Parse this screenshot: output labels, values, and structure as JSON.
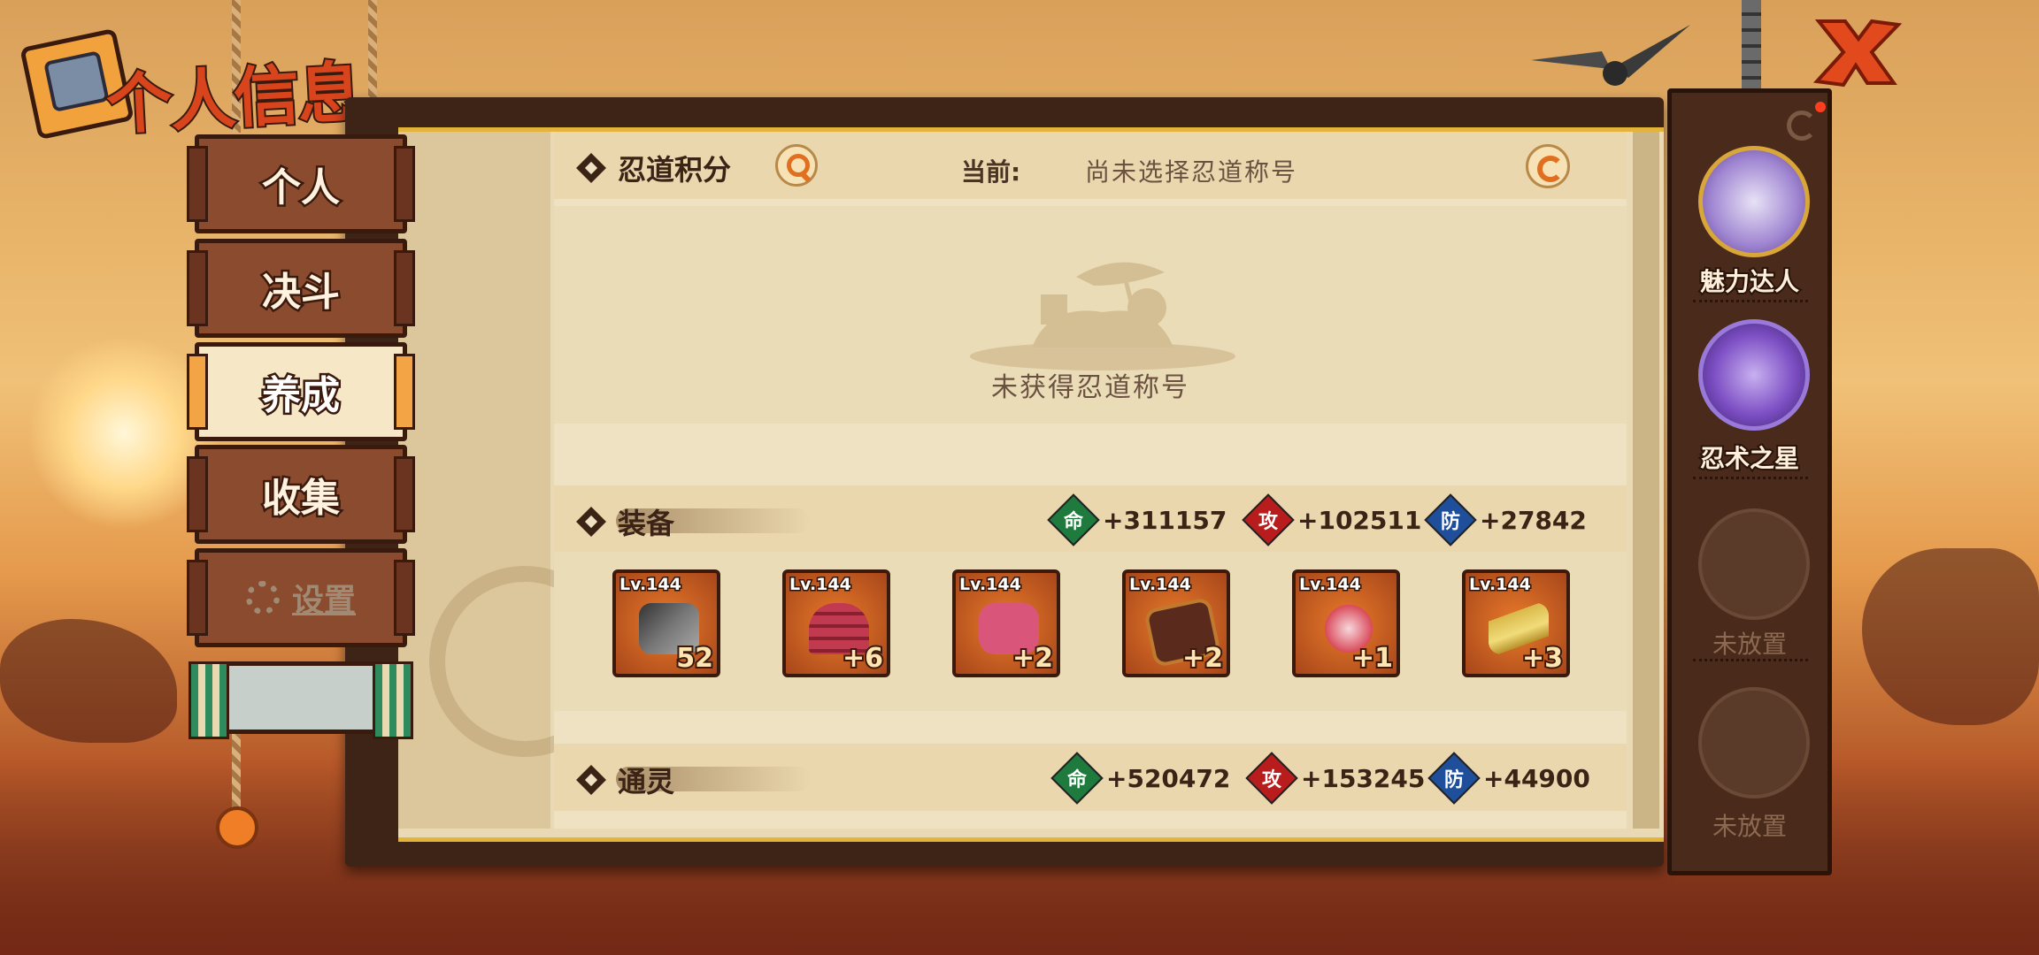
{
  "title": "个人信息",
  "menu": [
    {
      "label": "个人",
      "active": false
    },
    {
      "label": "决斗",
      "active": false
    },
    {
      "label": "养成",
      "active": true
    },
    {
      "label": "收集",
      "active": false
    },
    {
      "label": "设置",
      "active": false
    }
  ],
  "ninja_points": {
    "label": "忍道积分",
    "current_label": "当前:",
    "current_value": "尚未选择忍道称号",
    "no_title_text": "未获得忍道称号"
  },
  "equipment": {
    "label": "装备",
    "stats": {
      "hp_icon": "命",
      "hp": "+311157",
      "atk_icon": "攻",
      "atk": "+102511",
      "def_icon": "防",
      "def": "+27842"
    },
    "items": [
      {
        "level": "Lv.144",
        "plus": "52",
        "kind": "weapon-icon"
      },
      {
        "level": "Lv.144",
        "plus": "+6",
        "kind": "helmet-icon"
      },
      {
        "level": "Lv.144",
        "plus": "+2",
        "kind": "armor-icon"
      },
      {
        "level": "Lv.144",
        "plus": "+2",
        "kind": "scroll-book-icon"
      },
      {
        "level": "Lv.144",
        "plus": "+1",
        "kind": "claw-necklace-icon"
      },
      {
        "level": "Lv.144",
        "plus": "+3",
        "kind": "headband-icon"
      }
    ]
  },
  "summon": {
    "label": "通灵",
    "stats": {
      "hp_icon": "命",
      "hp": "+520472",
      "atk_icon": "攻",
      "atk": "+153245",
      "def_icon": "防",
      "def": "+44900"
    }
  },
  "right_panel": {
    "slots": [
      {
        "label": "魅力达人",
        "filled": true
      },
      {
        "label": "忍术之星",
        "filled": true
      },
      {
        "label": "未放置",
        "filled": false
      },
      {
        "label": "未放置",
        "filled": false
      }
    ]
  },
  "colors": {
    "hp": "#1f7a3e",
    "atk": "#b81c1c",
    "def": "#1f4e9a",
    "accent": "#e3b33a"
  }
}
